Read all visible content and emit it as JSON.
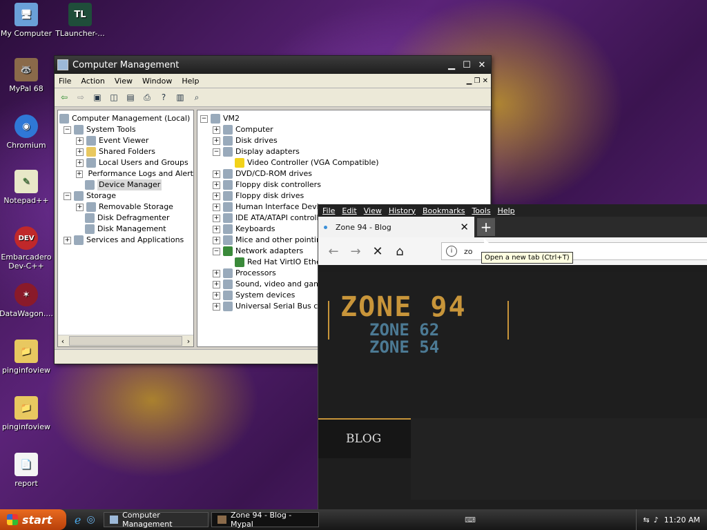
{
  "desktop": {
    "icons": [
      {
        "label": "My Computer",
        "glyph": "🖥"
      },
      {
        "label": "TLauncher-...",
        "glyph": "TL"
      },
      {
        "label": "MyPal 68",
        "glyph": "🦝"
      },
      {
        "label": "Chromium",
        "glyph": "◉"
      },
      {
        "label": "Notepad++",
        "glyph": "✎"
      },
      {
        "label": "Embarcadero Dev-C++",
        "glyph": "DEV"
      },
      {
        "label": "DataWagon....",
        "glyph": "✶"
      },
      {
        "label": "pinginfoview",
        "glyph": "📁"
      },
      {
        "label": "pinginfoview",
        "glyph": "📁"
      },
      {
        "label": "report",
        "glyph": "📄"
      }
    ]
  },
  "compmgmt": {
    "title": "Computer Management",
    "menu": [
      "File",
      "Action",
      "View",
      "Window",
      "Help"
    ],
    "left_tree": [
      "Computer Management (Local)",
      "System Tools",
      "Event Viewer",
      "Shared Folders",
      "Local Users and Groups",
      "Performance Logs and Alerts",
      "Device Manager",
      "Storage",
      "Removable Storage",
      "Disk Defragmenter",
      "Disk Management",
      "Services and Applications"
    ],
    "right_tree": [
      "VM2",
      "Computer",
      "Disk drives",
      "Display adapters",
      "Video Controller (VGA Compatible)",
      "DVD/CD-ROM drives",
      "Floppy disk controllers",
      "Floppy disk drives",
      "Human Interface Devices",
      "IDE ATA/ATAPI controllers",
      "Keyboards",
      "Mice and other pointing devices",
      "Network adapters",
      "Red Hat VirtIO Ethernet Adapter",
      "Processors",
      "Sound, video and game controllers",
      "System devices",
      "Universal Serial Bus controllers"
    ]
  },
  "browser": {
    "menu": [
      "File",
      "Edit",
      "View",
      "History",
      "Bookmarks",
      "Tools",
      "Help"
    ],
    "tab_title": "Zone 94 - Blog",
    "url_text": "zo",
    "tooltip": "Open a new tab (Ctrl+T)",
    "logo_main": "ZONE 94",
    "logo_sub1": "ZONE 62",
    "logo_sub2": "ZONE 54",
    "nav_item": "BLOG"
  },
  "taskbar": {
    "start_label": "start",
    "tasks": [
      "Computer Management",
      "Zone 94 - Blog - Mypal"
    ],
    "clock": "11:20 AM"
  }
}
